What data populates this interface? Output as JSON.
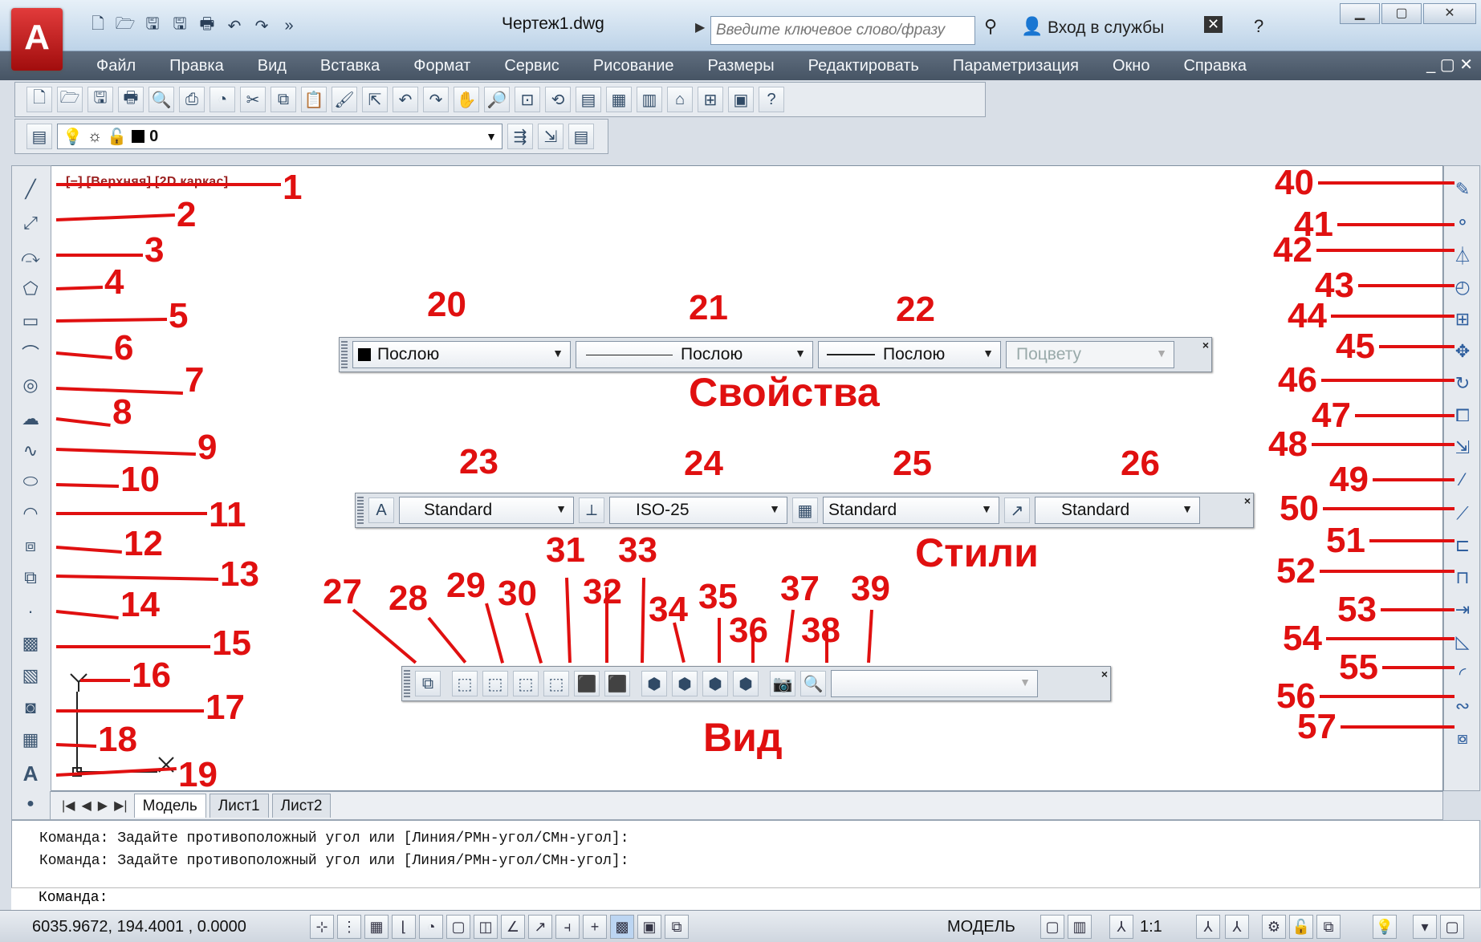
{
  "window": {
    "logo": "A",
    "doc_title": "Чертеж1.dwg",
    "search_placeholder": "Введите ключевое слово/фразу",
    "login": "Вход в службы"
  },
  "menu": [
    "Файл",
    "Правка",
    "Вид",
    "Вставка",
    "Формат",
    "Сервис",
    "Рисование",
    "Размеры",
    "Редактировать",
    "Параметризация",
    "Окно",
    "Справка"
  ],
  "layer": {
    "name": "0"
  },
  "viewport_label": "[−] [Верхняя] [2D каркас]",
  "properties": {
    "title": "Свойства",
    "color": "Послою",
    "linetype": "Послою",
    "lineweight": "Послою",
    "plotstyle": "Поцвету"
  },
  "styles": {
    "title": "Стили",
    "text_style": "Standard",
    "dim_style": "ISO-25",
    "table_style": "Standard",
    "mleader_style": "Standard"
  },
  "view": {
    "title": "Вид"
  },
  "callouts": [
    "1",
    "2",
    "3",
    "4",
    "5",
    "6",
    "7",
    "8",
    "9",
    "10",
    "11",
    "12",
    "13",
    "14",
    "15",
    "16",
    "17",
    "18",
    "19",
    "20",
    "21",
    "22",
    "23",
    "24",
    "25",
    "26",
    "27",
    "28",
    "29",
    "30",
    "31",
    "32",
    "33",
    "34",
    "35",
    "36",
    "37",
    "38",
    "39",
    "40",
    "41",
    "42",
    "43",
    "44",
    "45",
    "46",
    "47",
    "48",
    "49",
    "50",
    "51",
    "52",
    "53",
    "54",
    "55",
    "56",
    "57"
  ],
  "tabs": [
    "Модель",
    "Лист1",
    "Лист2"
  ],
  "command_lines": [
    "Команда: Задайте противоположный угол или [Линия/РМн-угол/СМн-угол]:",
    "Команда: Задайте противоположный угол или [Линия/РМн-угол/СМн-угол]:"
  ],
  "command_prompt": "Команда:",
  "status": {
    "coords": "6035.9672, 194.4001 , 0.0000",
    "model": "МОДЕЛЬ",
    "scale": "1:1"
  },
  "colors": {
    "accent": "#e01010",
    "menubar": "#4f5d6e"
  }
}
